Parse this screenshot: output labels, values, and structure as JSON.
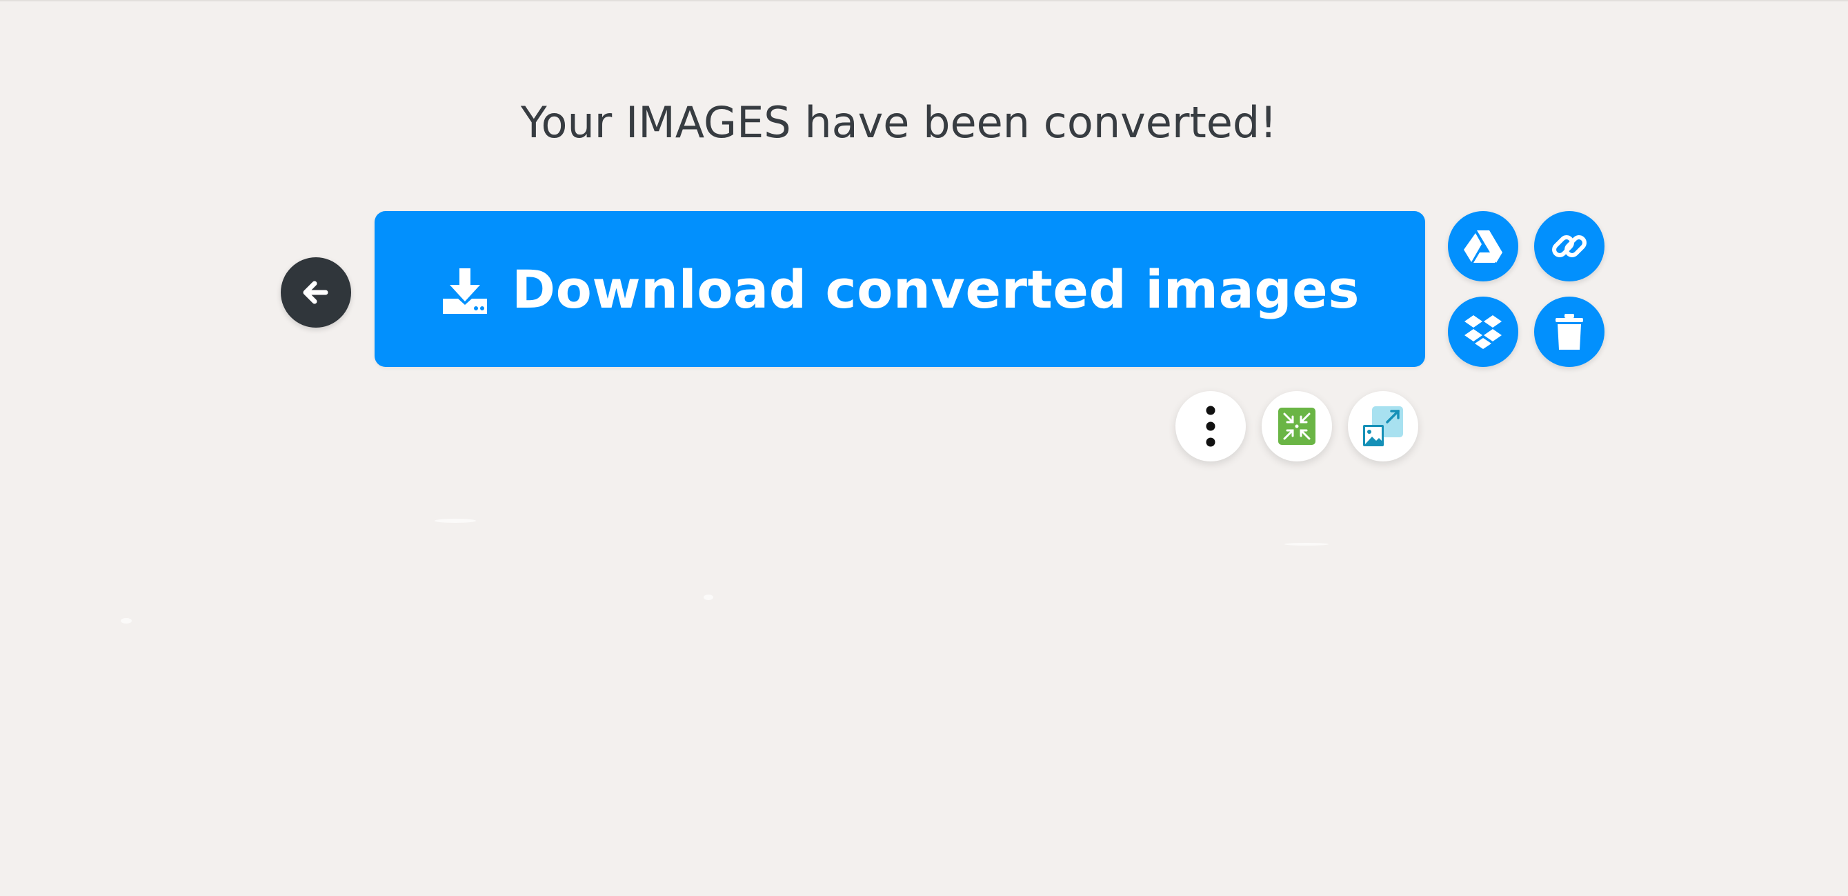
{
  "page": {
    "heading": "Your IMAGES have been converted!"
  },
  "actions": {
    "download_label": "Download converted images"
  },
  "icons": {
    "back": "arrow-left-icon",
    "download": "download-icon",
    "google_drive": "google-drive-icon",
    "link": "link-icon",
    "dropbox": "dropbox-icon",
    "delete": "trash-icon",
    "more": "more-vertical-icon",
    "compress": "compress-icon",
    "resize": "resize-image-icon"
  },
  "colors": {
    "accent": "#0290fd",
    "dark": "#30363b",
    "background": "#f3f0ee",
    "compress_green": "#6ab545",
    "resize_light_blue": "#a8e1f0",
    "resize_teal": "#1590b7"
  }
}
